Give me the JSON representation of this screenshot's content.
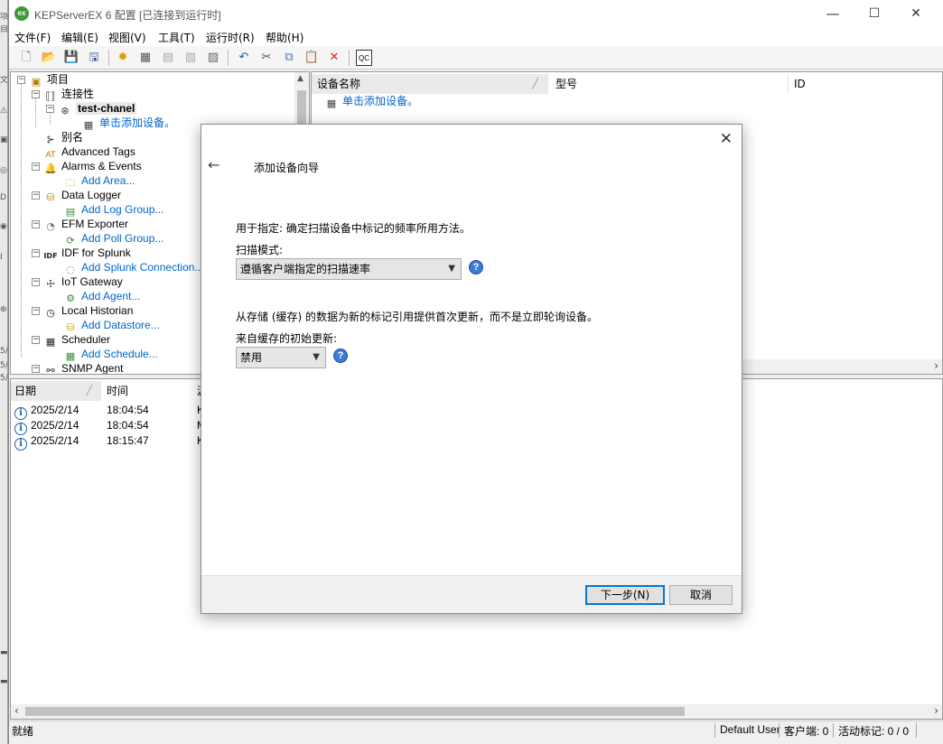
{
  "window": {
    "title": "KEPServerEX 6 配置 [已连接到运行时]",
    "app_icon_text": "ex"
  },
  "menu": [
    "文件(F)",
    "编辑(E)",
    "视图(V)",
    "工具(T)",
    "运行时(R)",
    "帮助(H)"
  ],
  "tree": {
    "project": "项目",
    "connectivity": "连接性",
    "channel": "test-chanel",
    "add_device": "单击添加设备。",
    "alias": "别名",
    "advanced_tags": "Advanced Tags",
    "alarms_events": "Alarms & Events",
    "add_area": "Add Area...",
    "data_logger": "Data Logger",
    "add_log_group": "Add Log Group...",
    "efm_exporter": "EFM Exporter",
    "add_poll_group": "Add Poll Group...",
    "idf_splunk": "IDF for Splunk",
    "add_splunk": "Add Splunk Connection...",
    "iot_gateway": "IoT Gateway",
    "add_agent": "Add Agent...",
    "local_historian": "Local Historian",
    "add_datastore": "Add Datastore...",
    "scheduler": "Scheduler",
    "add_schedule": "Add Schedule...",
    "snmp_agent": "SNMP Agent"
  },
  "device_list": {
    "col_name": "设备名称",
    "col_model": "型号",
    "col_id": "ID",
    "add_device": "单击添加设备。"
  },
  "log": {
    "col_date": "日期",
    "col_time": "时间",
    "col_source": "源",
    "rows": [
      {
        "date": "2025/2/14",
        "time": "18:04:54",
        "source": "K"
      },
      {
        "date": "2025/2/14",
        "time": "18:04:54",
        "source": "M"
      },
      {
        "date": "2025/2/14",
        "time": "18:15:47",
        "source": "K"
      }
    ]
  },
  "status": {
    "ready": "就绪",
    "user": "Default User",
    "clients": "客户端: 0",
    "active_tags": "活动标记: 0 / 0"
  },
  "dialog": {
    "title": "添加设备向导",
    "desc1": "用于指定: 确定扫描设备中标记的频率所用方法。",
    "label1": "扫描模式:",
    "scan_mode_value": "遵循客户端指定的扫描速率",
    "desc2": "从存储 (缓存) 的数据为新的标记引用提供首次更新，而不是立即轮询设备。",
    "label2": "来自缓存的初始更新:",
    "initial_update_value": "禁用",
    "next_button": "下一步(N)",
    "cancel_button": "取消"
  },
  "icons": {
    "help": "?",
    "close": "✕",
    "back": "←",
    "info": "i"
  }
}
